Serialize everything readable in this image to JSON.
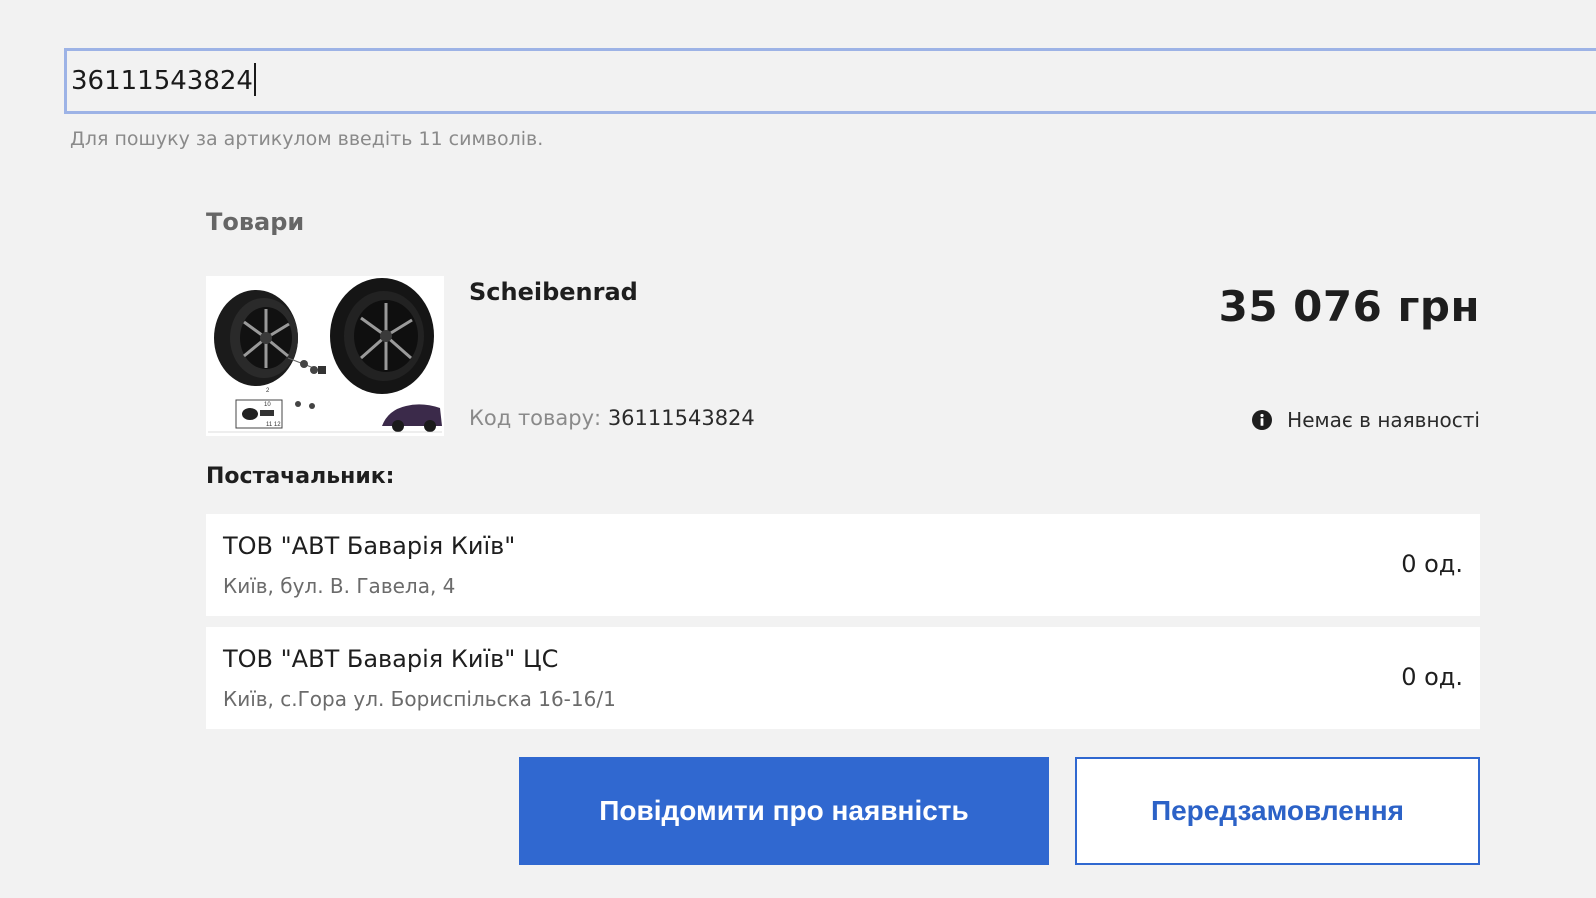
{
  "search": {
    "value": "36111543824",
    "hint": "Для пошуку за артикулом введіть 11 символів."
  },
  "products_section": {
    "title": "Товари"
  },
  "product": {
    "name": "Scheibenrad",
    "price": "35 076 грн",
    "code_label": "Код товару:",
    "code_value": "36111543824",
    "stock_status": "Немає в наявності",
    "image_label": "wheel-and-tire-diagram"
  },
  "suppliers": {
    "title": "Постачальник:",
    "items": [
      {
        "name": "ТОВ \"АВТ Баварія Київ\"",
        "address": "Київ, бул. В. Гавела, 4",
        "qty": "0 од."
      },
      {
        "name": "ТОВ \"АВТ Баварія Київ\" ЦС",
        "address": "Київ, с.Гора ул. Бориспільска 16-16/1",
        "qty": "0 од."
      }
    ]
  },
  "actions": {
    "notify_label": "Повідомити про наявність",
    "preorder_label": "Передзамовлення"
  },
  "colors": {
    "background": "#f2f2f2",
    "accent": "#3068d0",
    "input_focus_border": "#9db3e6"
  },
  "icons": {
    "stock_status_icon": "info-icon"
  }
}
